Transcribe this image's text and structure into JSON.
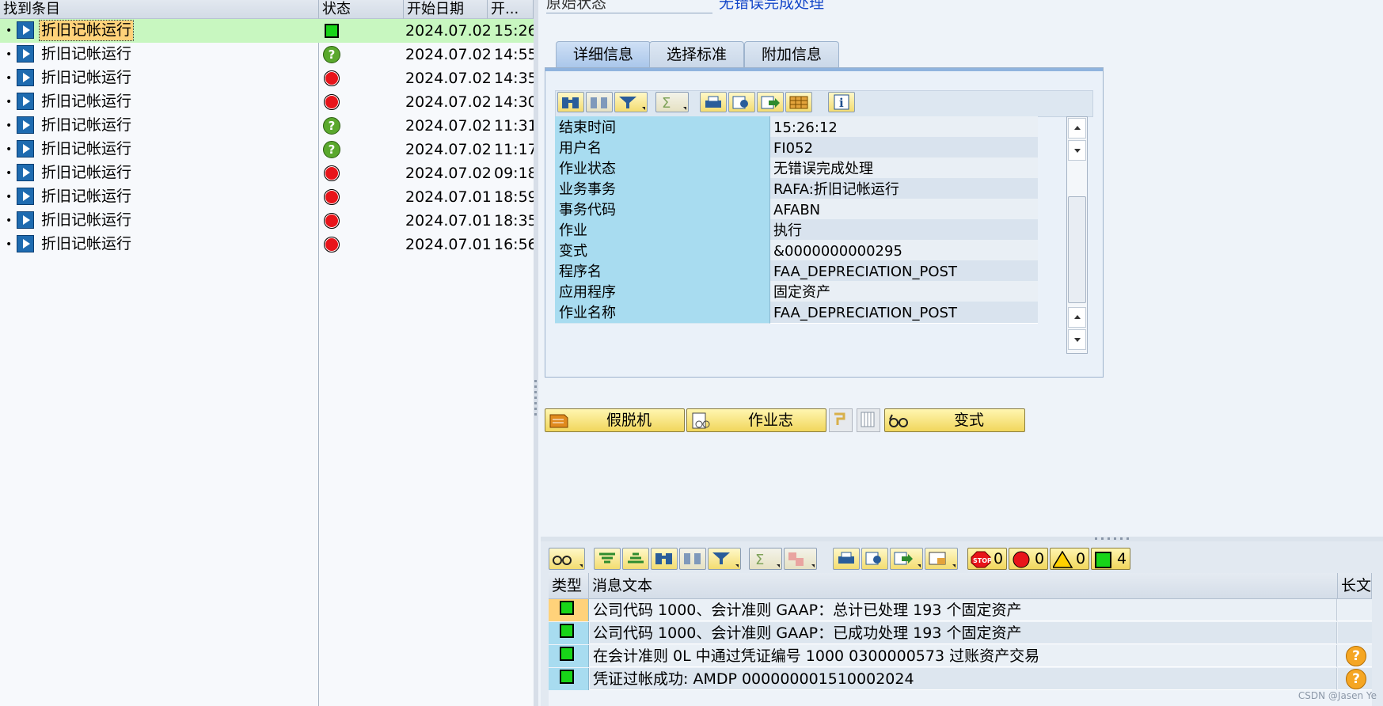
{
  "tree": {
    "columns": [
      "找到条目",
      "状态",
      "开始日期",
      "开..."
    ],
    "rows": [
      {
        "name": "折旧记帐运行",
        "status": "green-square",
        "date": "2024.07.02",
        "time": "15:26",
        "selected": true
      },
      {
        "name": "折旧记帐运行",
        "status": "question",
        "date": "2024.07.02",
        "time": "14:55"
      },
      {
        "name": "折旧记帐运行",
        "status": "red",
        "date": "2024.07.02",
        "time": "14:35"
      },
      {
        "name": "折旧记帐运行",
        "status": "red",
        "date": "2024.07.02",
        "time": "14:30"
      },
      {
        "name": "折旧记帐运行",
        "status": "question",
        "date": "2024.07.02",
        "time": "11:31"
      },
      {
        "name": "折旧记帐运行",
        "status": "question",
        "date": "2024.07.02",
        "time": "11:17"
      },
      {
        "name": "折旧记帐运行",
        "status": "red",
        "date": "2024.07.02",
        "time": "09:18"
      },
      {
        "name": "折旧记帐运行",
        "status": "red",
        "date": "2024.07.01",
        "time": "18:59"
      },
      {
        "name": "折旧记帐运行",
        "status": "red",
        "date": "2024.07.01",
        "time": "18:35"
      },
      {
        "name": "折旧记帐运行",
        "status": "red",
        "date": "2024.07.01",
        "time": "16:56"
      }
    ]
  },
  "header": {
    "status_label": "原始状态",
    "status_value": "无错误完成处理"
  },
  "tabs": [
    "详细信息",
    "选择标准",
    "附加信息"
  ],
  "details": [
    {
      "key": "结束时间",
      "value": "15:26:12"
    },
    {
      "key": "用户名",
      "value": "FI052"
    },
    {
      "key": "作业状态",
      "value": "无错误完成处理"
    },
    {
      "key": "业务事务",
      "value": "RAFA:折旧记帐运行"
    },
    {
      "key": "事务代码",
      "value": "AFABN"
    },
    {
      "key": "作业",
      "value": "执行"
    },
    {
      "key": "变式",
      "value": "&0000000000295"
    },
    {
      "key": "程序名",
      "value": "FAA_DEPRECIATION_POST"
    },
    {
      "key": "应用程序",
      "value": "固定资产"
    },
    {
      "key": "作业名称",
      "value": "FAA_DEPRECIATION_POST"
    }
  ],
  "actions": {
    "simulate": "假脱机",
    "job_log": "作业志",
    "variant": "变式"
  },
  "counters": {
    "stop": "0",
    "error": "0",
    "warning": "0",
    "success": "4"
  },
  "messages": {
    "columns": [
      "类型",
      "消息文本",
      "长文..."
    ],
    "rows": [
      {
        "text": "公司代码 1000、会计准则 GAAP：总计已处理 193 个固定资产",
        "longtext": false,
        "selected": true
      },
      {
        "text": "公司代码 1000、会计准则 GAAP：已成功处理 193 个固定资产",
        "longtext": false
      },
      {
        "text": "在会计准则 0L 中通过凭证编号 1000 0300000573 过账资产交易",
        "longtext": true
      },
      {
        "text": "凭证过帐成功: AMDP 000000001510002024",
        "longtext": true
      }
    ]
  },
  "watermark": "CSDN @Jasen Ye",
  "colors": {
    "accent_blue": "#1447c9",
    "key_cell": "#a8dcf0",
    "selected_row": "#c8f7c0",
    "selected_cell": "#ffd27a",
    "button_yellow": "#f1d65c"
  }
}
